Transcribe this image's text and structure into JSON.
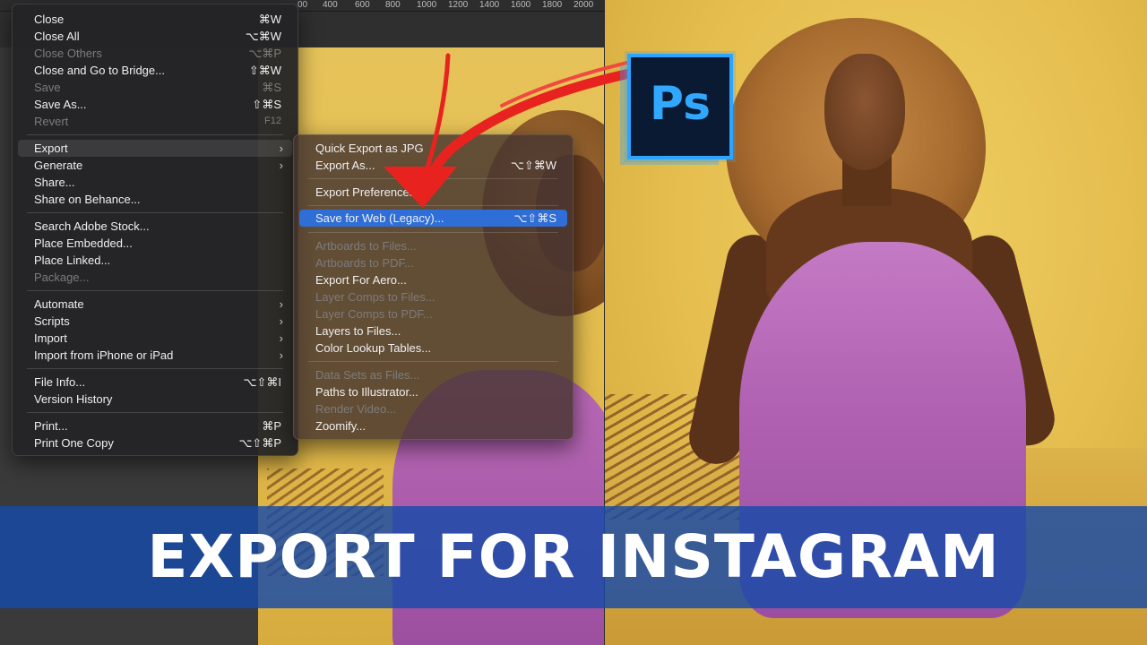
{
  "ruler": {
    "ticks": [
      "00",
      "400",
      "600",
      "800",
      "1000",
      "1200",
      "1400",
      "1600",
      "1800",
      "2000"
    ]
  },
  "file_menu": {
    "items": [
      {
        "label": "Close",
        "shortcut": "⌘W"
      },
      {
        "label": "Close All",
        "shortcut": "⌥⌘W"
      },
      {
        "label": "Close Others",
        "shortcut": "⌥⌘P",
        "disabled": true
      },
      {
        "label": "Close and Go to Bridge...",
        "shortcut": "⇧⌘W"
      },
      {
        "label": "Save",
        "shortcut": "⌘S",
        "disabled": true
      },
      {
        "label": "Save As...",
        "shortcut": "⇧⌘S"
      },
      {
        "label": "Revert",
        "shortcut": "F12",
        "disabled": true
      },
      {
        "label": "Export",
        "submenu": true
      },
      {
        "label": "Generate",
        "submenu": true
      },
      {
        "label": "Share..."
      },
      {
        "label": "Share on Behance..."
      },
      {
        "label": "Search Adobe Stock..."
      },
      {
        "label": "Place Embedded..."
      },
      {
        "label": "Place Linked..."
      },
      {
        "label": "Package...",
        "disabled": true
      },
      {
        "label": "Automate",
        "submenu": true
      },
      {
        "label": "Scripts",
        "submenu": true
      },
      {
        "label": "Import",
        "submenu": true
      },
      {
        "label": "Import from iPhone or iPad",
        "submenu": true
      },
      {
        "label": "File Info...",
        "shortcut": "⌥⇧⌘I"
      },
      {
        "label": "Version History"
      },
      {
        "label": "Print...",
        "shortcut": "⌘P"
      },
      {
        "label": "Print One Copy",
        "shortcut": "⌥⇧⌘P"
      }
    ]
  },
  "export_menu": {
    "items": [
      {
        "label": "Quick Export as JPG"
      },
      {
        "label": "Export As...",
        "shortcut": "⌥⇧⌘W"
      },
      {
        "label": "Export Preferences..."
      },
      {
        "label": "Save for Web (Legacy)...",
        "shortcut": "⌥⇧⌘S"
      },
      {
        "label": "Artboards to Files...",
        "disabled": true
      },
      {
        "label": "Artboards to PDF...",
        "disabled": true
      },
      {
        "label": "Export For Aero..."
      },
      {
        "label": "Layer Comps to Files...",
        "disabled": true
      },
      {
        "label": "Layer Comps to PDF...",
        "disabled": true
      },
      {
        "label": "Layers to Files..."
      },
      {
        "label": "Color Lookup Tables..."
      },
      {
        "label": "Data Sets as Files...",
        "disabled": true
      },
      {
        "label": "Paths to Illustrator..."
      },
      {
        "label": "Render Video...",
        "disabled": true
      },
      {
        "label": "Zoomify..."
      }
    ]
  },
  "logo": {
    "text": "Ps"
  },
  "banner": {
    "text": "EXPORT FOR INSTAGRAM"
  },
  "colors": {
    "accent": "#2f6ed6",
    "banner": "#164aaa",
    "arrow": "#e8231f",
    "ps_blue": "#31a8ff"
  }
}
